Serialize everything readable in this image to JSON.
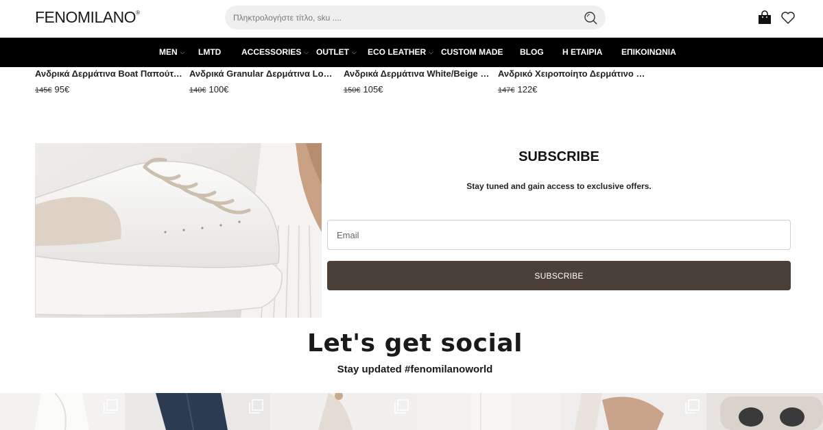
{
  "header": {
    "logo": "FENOMILANO",
    "logo_mark": "®",
    "search_placeholder": "Πληκτρολογήστε τίτλο, sku ...."
  },
  "nav": {
    "items": [
      {
        "label": "MEN",
        "dropdown": true
      },
      {
        "label": "LMTD",
        "dropdown": false
      },
      {
        "label": "ACCESSORIES",
        "dropdown": true
      },
      {
        "label": "OUTLET",
        "dropdown": true
      },
      {
        "label": "ECO LEATHER",
        "dropdown": true
      },
      {
        "label": "CUSTOM MADE",
        "dropdown": false
      },
      {
        "label": "BLOG",
        "dropdown": false
      },
      {
        "label": "Η ΕΤΑΙΡΙΑ",
        "dropdown": false
      },
      {
        "label": "ΕΠΙΚΟΙΝΩΝΙΑ",
        "dropdown": false
      }
    ]
  },
  "products": [
    {
      "name": "Ανδρικά Δερμάτινα Boat Παπούτσια",
      "old_price": "145€",
      "price": "95€"
    },
    {
      "name": "Ανδρικά Granular Δερμάτινα Loafers",
      "old_price": "140€",
      "price": "100€"
    },
    {
      "name": "Ανδρικά Δερμάτινα White/Beige Sneakers",
      "old_price": "150€",
      "price": "105€"
    },
    {
      "name": "Ανδρικό Χειροποίητο Δερμάτινο Loafer",
      "old_price": "147€",
      "price": "122€"
    }
  ],
  "subscribe": {
    "title": "SUBSCRIBE",
    "text": "Stay tuned and gain access to exclusive offers.",
    "email_placeholder": "Email",
    "button_label": "SUBSCRIBE"
  },
  "social": {
    "title": "Let's get social",
    "subtitle": "Stay updated #fenomilanoworld"
  },
  "colors": {
    "nav_bg": "#000000",
    "button_bg": "#4a4037",
    "search_bg": "#efefef"
  },
  "icons": [
    "search-icon",
    "shopping-bag-icon",
    "heart-icon",
    "chevron-down-icon",
    "multiple-images-icon"
  ]
}
